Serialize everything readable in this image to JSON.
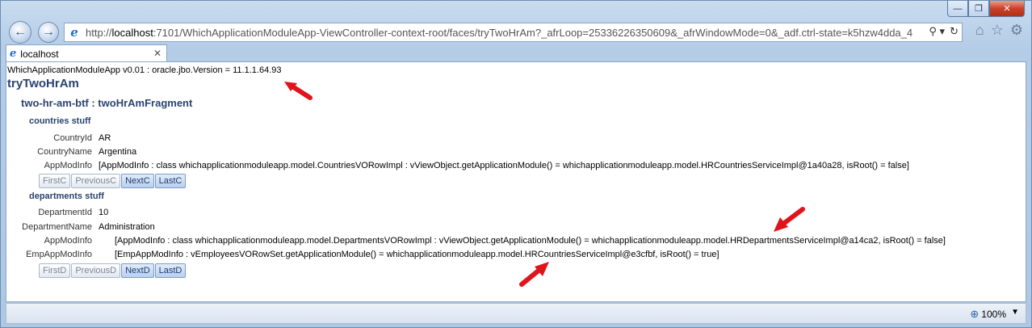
{
  "window": {
    "controls": {
      "minimize": "—",
      "maximize": "❐",
      "close": "✕"
    }
  },
  "nav": {
    "back_icon": "arrow-left-icon",
    "forward_icon": "arrow-right-icon",
    "url_prefix": "http://",
    "url_host": "localhost",
    "url_rest": ":7101/WhichApplicationModuleApp-ViewController-context-root/faces/tryTwoHrAm?_afrLoop=25336226350609&_afrWindowMode=0&_adf.ctrl-state=k5hzw4dda_4",
    "search_glyph": "⚲ ▾",
    "refresh_glyph": "↻",
    "toolbar_glyphs": [
      "⌂",
      "☆",
      "⚙"
    ]
  },
  "tab": {
    "title": "localhost",
    "close": "✕"
  },
  "page": {
    "version_line": "WhichApplicationModuleApp v0.01 : oracle.jbo.Version = 11.1.1.64.93",
    "title": "tryTwoHrAm",
    "fragment": "two-hr-am-btf : twoHrAmFragment",
    "countries": {
      "header": "countries stuff",
      "fields": [
        {
          "label": "CountryId",
          "value": "AR"
        },
        {
          "label": "CountryName",
          "value": "Argentina"
        },
        {
          "label": "AppModInfo",
          "value": "[AppModInfo : class whichapplicationmoduleapp.model.CountriesVORowImpl : vViewObject.getApplicationModule() = whichapplicationmoduleapp.model.HRCountriesServiceImpl@1a40a28, isRoot() = false]"
        }
      ],
      "buttons": [
        {
          "label": "FirstC",
          "enabled": false
        },
        {
          "label": "PreviousC",
          "enabled": false
        },
        {
          "label": "NextC",
          "enabled": true
        },
        {
          "label": "LastC",
          "enabled": true
        }
      ]
    },
    "departments": {
      "header": "departments stuff",
      "fields": [
        {
          "label": "DepartmentId",
          "value": "10"
        },
        {
          "label": "DepartmentName",
          "value": "Administration"
        },
        {
          "label": "AppModInfo",
          "value": "[AppModInfo : class whichapplicationmoduleapp.model.DepartmentsVORowImpl : vViewObject.getApplicationModule() = whichapplicationmoduleapp.model.HRDepartmentsServiceImpl@a14ca2, isRoot() = false]"
        },
        {
          "label": "EmpAppModInfo",
          "value": "[EmpAppModInfo : vEmployeesVORowSet.getApplicationModule() = whichapplicationmoduleapp.model.HRCountriesServiceImpl@e3cfbf, isRoot() = true]"
        }
      ],
      "buttons": [
        {
          "label": "FirstD",
          "enabled": false
        },
        {
          "label": "PreviousD",
          "enabled": false
        },
        {
          "label": "NextD",
          "enabled": true
        },
        {
          "label": "LastD",
          "enabled": true
        }
      ]
    }
  },
  "status": {
    "zoom": "100%",
    "zoom_icon": "zoom-icon"
  },
  "colors": {
    "arrow": "#e0141a",
    "heading": "#2a4370"
  }
}
